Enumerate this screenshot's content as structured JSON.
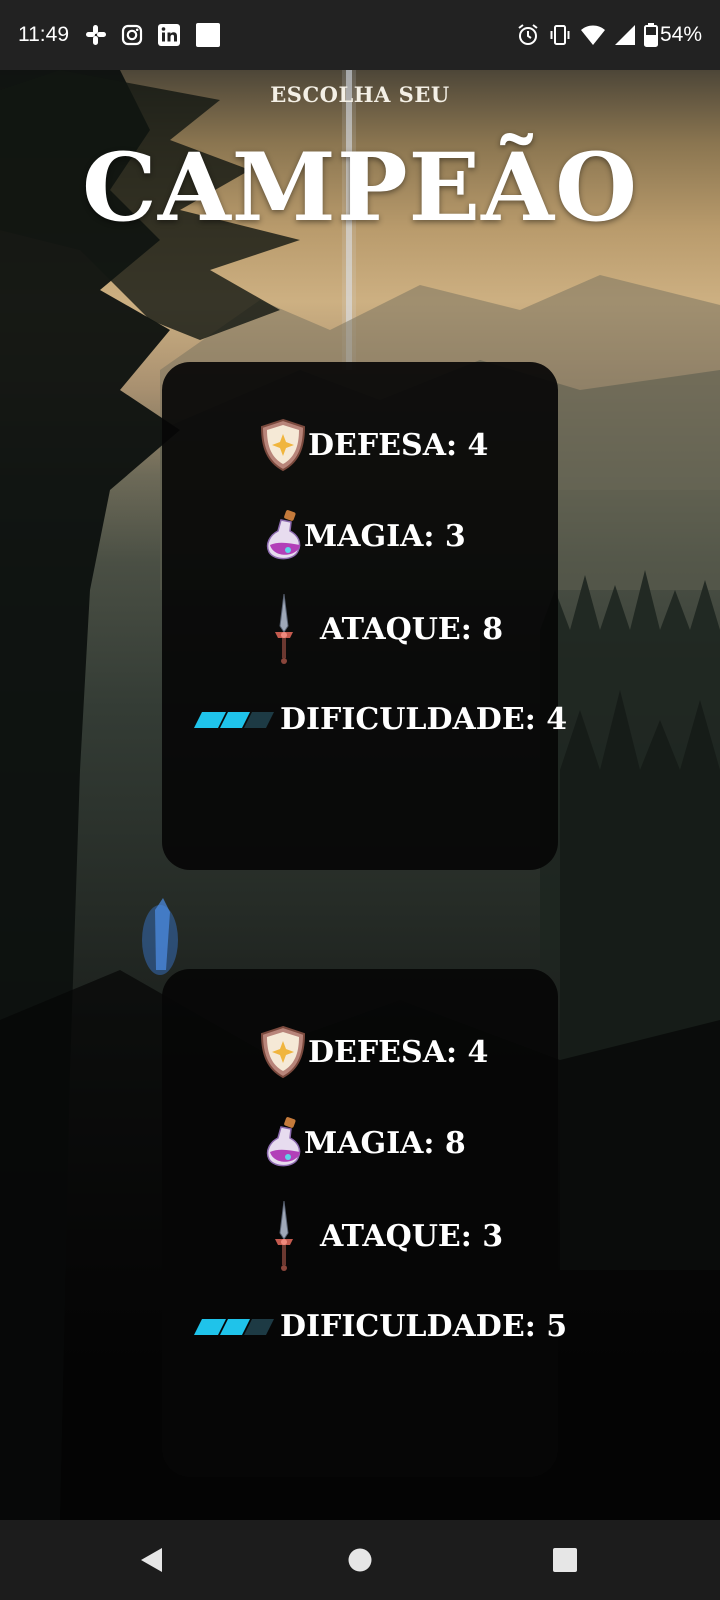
{
  "status_bar": {
    "time": "11:49",
    "battery": "54%",
    "left_icons": [
      "slack-icon",
      "instagram-icon",
      "linkedin-icon",
      "app-square-icon"
    ],
    "right_icons": [
      "alarm-icon",
      "vibrate-icon",
      "wifi-icon",
      "signal-icon",
      "battery-icon"
    ]
  },
  "header": {
    "subtitle": "ESCOLHA SEU",
    "title": "CAMPEÃO"
  },
  "champions": [
    {
      "defense": "DEFESA: 4",
      "magic": "MAGIA: 3",
      "attack": "ATAQUE: 8",
      "difficulty": "DIFICULDADE: 4"
    },
    {
      "defense": "DEFESA: 4",
      "magic": "MAGIA: 8",
      "attack": "ATAQUE: 3",
      "difficulty": "DIFICULDADE: 5"
    }
  ],
  "stat_icons": [
    "shield-icon",
    "potion-icon",
    "dagger-icon",
    "difficulty-bar-icon"
  ],
  "colors": {
    "card_background": "#060606",
    "text": "#ffffff",
    "difficulty_accent": "#1fc3ea",
    "status_bar": "#222222",
    "nav_bar": "#1c1c1c"
  },
  "nav_bar": [
    "back-icon",
    "home-icon",
    "recents-icon"
  ]
}
